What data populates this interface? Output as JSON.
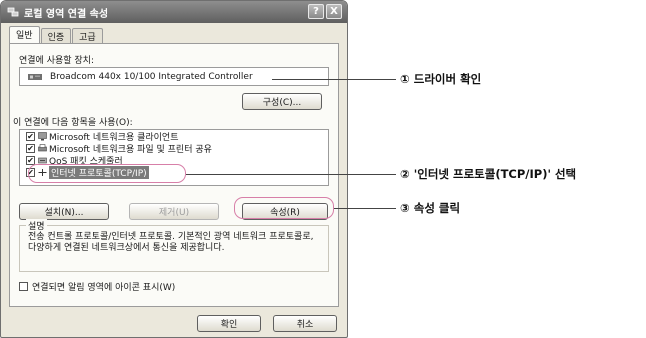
{
  "window": {
    "title": "로컬 영역 연결 속성",
    "help_button": "?",
    "close_button": "X"
  },
  "tabs": [
    {
      "label": "일반",
      "active": true
    },
    {
      "label": "인증",
      "active": false
    },
    {
      "label": "고급",
      "active": false
    }
  ],
  "connect_using": {
    "label": "연결에 사용할 장치:",
    "device": "Broadcom 440x 10/100 Integrated Controller",
    "device_icon": "network-card-icon",
    "configure_button": "구성(C)..."
  },
  "items": {
    "label": "이 연결에 다음 항목을 사용(O):",
    "list": [
      {
        "label": "Microsoft 네트워크용 클라이언트",
        "checked": true,
        "icon": "client-icon",
        "selected": false
      },
      {
        "label": "Microsoft 네트워크용 파일 및 프린터 공유",
        "checked": true,
        "icon": "printer-share-icon",
        "selected": false
      },
      {
        "label": "QoS 패킷 스케줄러",
        "checked": true,
        "icon": "scheduler-icon",
        "selected": false
      },
      {
        "label": "인터넷 프로토콜(TCP/IP)",
        "checked": true,
        "icon": "protocol-icon",
        "selected": true
      }
    ]
  },
  "buttons": {
    "install": "설치(N)...",
    "uninstall": "제거(U)",
    "properties": "속성(R)",
    "ok": "확인",
    "cancel": "취소"
  },
  "description": {
    "legend": "설명",
    "text": "전송 컨트롤 프로토콜/인터넷 프로토콜. 기본적인 광역 네트워크 프로토콜로, 다양하게 연결된 네트워크상에서 통신을 제공합니다."
  },
  "notify": {
    "label": "연결되면 알림 영역에 아이콘 표시(W)",
    "checked": false
  },
  "callouts": [
    {
      "text": "① 드라이버 확인"
    },
    {
      "text": "② '인터넷 프로토콜(TCP/IP)' 선택"
    },
    {
      "text": "③ 속성 클릭"
    }
  ],
  "colors": {
    "highlight": "#d77fa8",
    "selection": "#7a7a7a"
  }
}
